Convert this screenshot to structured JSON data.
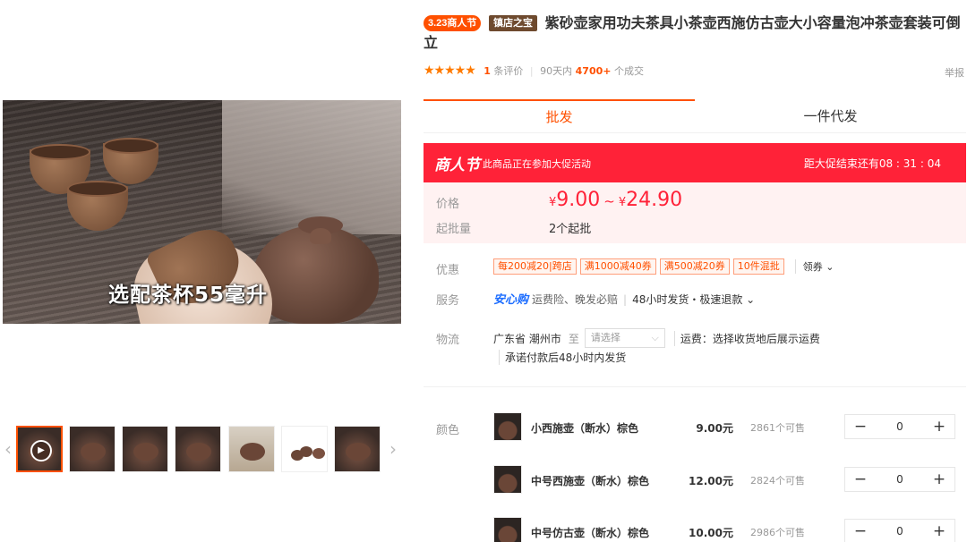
{
  "product": {
    "tags": {
      "festival": "3.23商人节",
      "treasure": "镇店之宝"
    },
    "title": "紫砂壶家用功夫茶具小茶壶西施仿古壶大小容量泡冲茶壶套装可倒立"
  },
  "rating": {
    "stars": "★★★★★",
    "review_count": "1",
    "review_suffix": "条评价",
    "period": "90天内",
    "sold": "4700+",
    "sold_suffix": "个成交",
    "report": "举报"
  },
  "gallery": {
    "video_caption": "选配茶杯55毫升",
    "thumbnail_count": 7
  },
  "tabs": [
    "批发",
    "一件代发"
  ],
  "promo": {
    "logo": "商人节",
    "text": "此商品正在参加大促活动",
    "countdown_prefix": "距大促结束还有",
    "countdown": "08 : 31 : 04"
  },
  "price": {
    "label": "价格",
    "currency": "¥",
    "min": "9.00",
    "tilde": "~",
    "max": "24.90",
    "moq_label": "起批量",
    "moq": "2个起批"
  },
  "coupons": {
    "label": "优惠",
    "items": [
      "每200减20|跨店",
      "满1000减40券",
      "满500减20券",
      "10件混批"
    ],
    "get_label": "领券 ⌄"
  },
  "service": {
    "label": "服务",
    "anxin": "安心购",
    "items": "运费险、晚发必赔",
    "delivery": "48小时发货・极速退款 ⌄"
  },
  "logistics": {
    "label": "物流",
    "origin": "广东省 潮州市",
    "to": "至",
    "select_placeholder": "请选择",
    "freight": "运费：选择收货地后展示运费",
    "promise": "承诺付款后48小时内发货"
  },
  "sku": {
    "label": "颜色",
    "rows": [
      {
        "name": "小西施壶（断水）棕色",
        "price": "9.00元",
        "stock": "2861个可售",
        "qty": "0"
      },
      {
        "name": "中号西施壶（断水）棕色",
        "price": "12.00元",
        "stock": "2824个可售",
        "qty": "0"
      },
      {
        "name": "中号仿古壶（断水）棕色",
        "price": "10.00元",
        "stock": "2986个可售",
        "qty": "0"
      }
    ],
    "minus": "−",
    "plus": "+"
  },
  "colors": {
    "accent": "#ff5000",
    "promo_red": "#ff2238",
    "price_bg": "#fff2f2",
    "anxin_blue": "#1c6dff"
  }
}
